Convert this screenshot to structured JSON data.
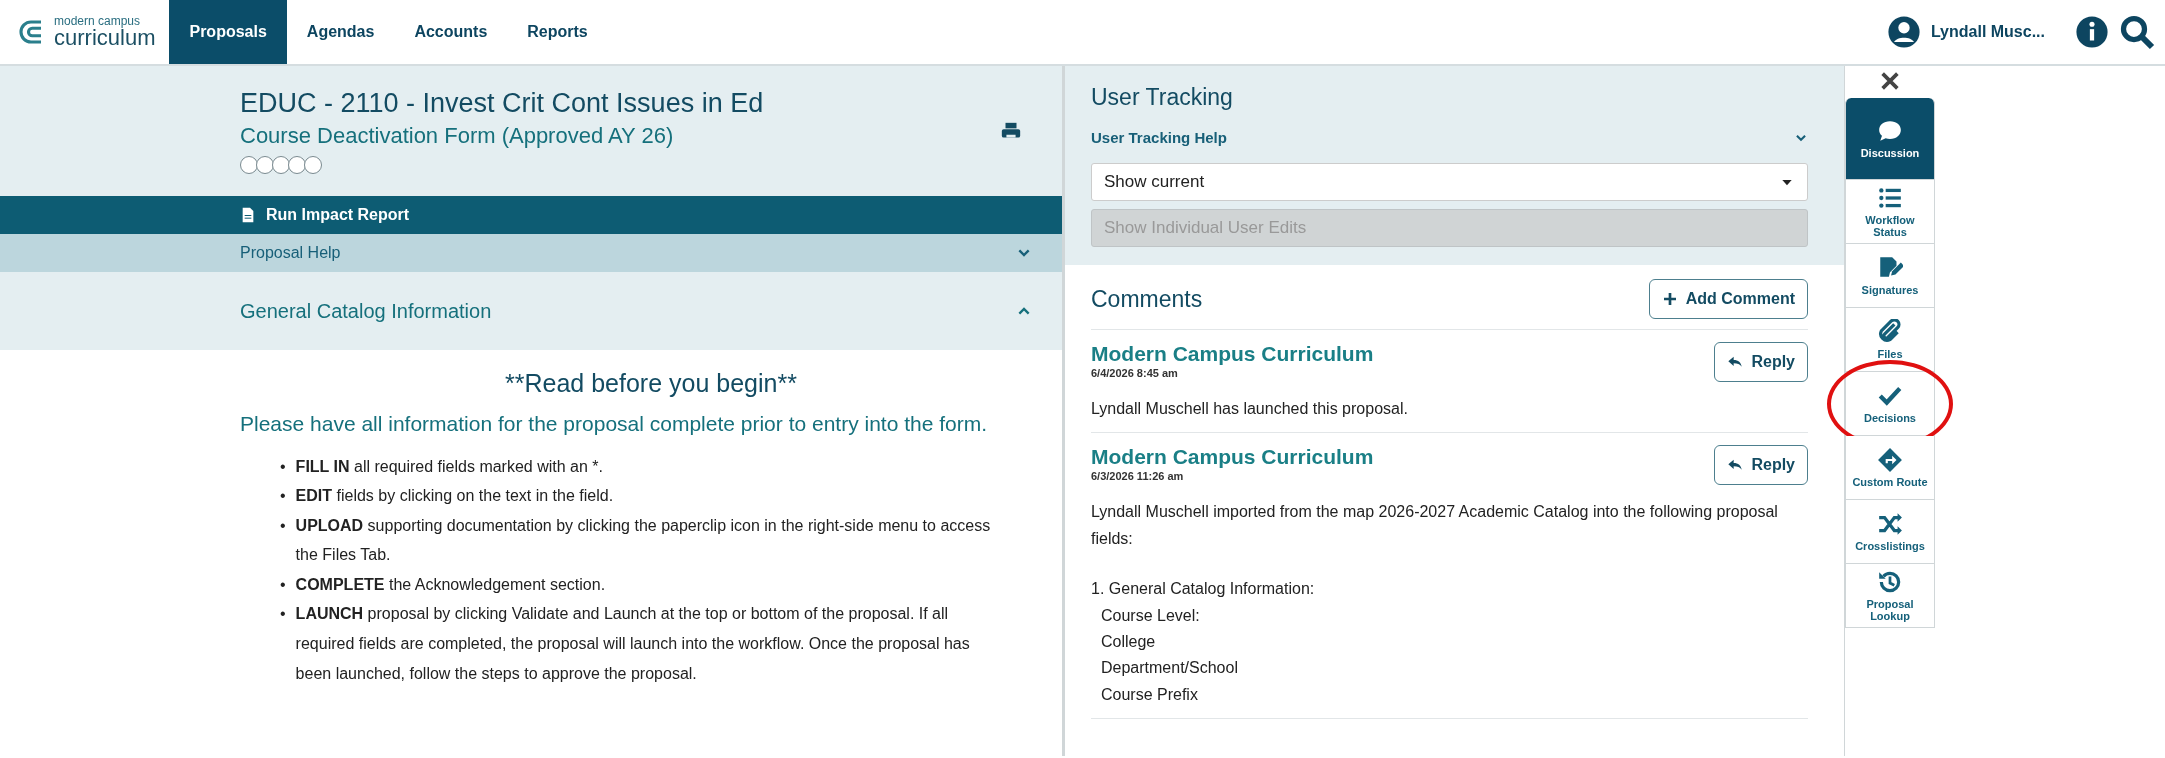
{
  "nav": {
    "logo_small": "modern campus",
    "logo_big": "curriculum",
    "tabs": [
      {
        "label": "Proposals",
        "selected": true
      },
      {
        "label": "Agendas",
        "selected": false
      },
      {
        "label": "Accounts",
        "selected": false
      },
      {
        "label": "Reports",
        "selected": false
      }
    ],
    "user": "Lyndall Musc..."
  },
  "proposal": {
    "title": "EDUC - 2110 - Invest Crit Cont Issues in Ed",
    "form": "Course Deactivation Form (Approved AY 26)",
    "stars": 0,
    "impact": "Run Impact Report",
    "help": "Proposal Help",
    "section": {
      "title": "General Catalog Information",
      "expanded": true
    }
  },
  "instructions": {
    "heading": "**Read before you begin**",
    "lead": "Please have all information for the proposal complete prior to entry into the form.",
    "bullets": [
      {
        "marker": "•",
        "text": "**FILL IN** all required fields marked with an *."
      },
      {
        "marker": "•",
        "text": "**EDIT** fields by clicking on the text in the field."
      },
      {
        "marker": "•",
        "text": "**UPLOAD** supporting documentation by clicking the paperclip icon in the right-side menu to access the Files Tab."
      },
      {
        "marker": "•",
        "text": "**COMPLETE** the Acknowledgement section."
      },
      {
        "marker": "•",
        "text": "**LAUNCH** proposal by clicking Validate and Launch at the top or bottom of the proposal.  If all required fields are completed, the proposal will launch into the workflow. Once the proposal has been launched, follow the steps to approve the proposal."
      }
    ]
  },
  "tracking": {
    "title": "User Tracking",
    "help": "User Tracking Help",
    "select": "Show current",
    "edits_placeholder": "Show Individual User Edits"
  },
  "comments": {
    "title": "Comments",
    "add": "Add Comment",
    "items": [
      {
        "author": "Modern Campus Curriculum",
        "date": "6/4/2026 8:45 am",
        "reply": "Reply",
        "body": "Lyndall Muschell has launched this proposal."
      },
      {
        "author": "Modern Campus Curriculum",
        "date": "6/3/2026 11:26 am",
        "reply": "Reply",
        "body": "Lyndall Muschell imported from the map 2026-2027 Academic Catalog into the following proposal fields:",
        "list_title": "1. General Catalog Information:",
        "list_items": [
          "Course Level:",
          "College",
          "Department/School",
          "Course Prefix"
        ]
      }
    ]
  },
  "side_tabs": [
    {
      "kind": "discussion",
      "label": "Discussion",
      "selected": true,
      "highlighted": false
    },
    {
      "kind": "workflow",
      "label": "Workflow Status",
      "selected": false,
      "highlighted": false
    },
    {
      "kind": "signatures",
      "label": "Signatures",
      "selected": false,
      "highlighted": false
    },
    {
      "kind": "files",
      "label": "Files",
      "selected": false,
      "highlighted": false
    },
    {
      "kind": "decisions",
      "label": "Decisions",
      "selected": false,
      "highlighted": true
    },
    {
      "kind": "route",
      "label": "Custom Route",
      "selected": false,
      "highlighted": false
    },
    {
      "kind": "crosslistings",
      "label": "Crosslistings",
      "selected": false,
      "highlighted": false
    },
    {
      "kind": "lookup",
      "label": "Proposal Lookup",
      "selected": false,
      "highlighted": false
    }
  ]
}
